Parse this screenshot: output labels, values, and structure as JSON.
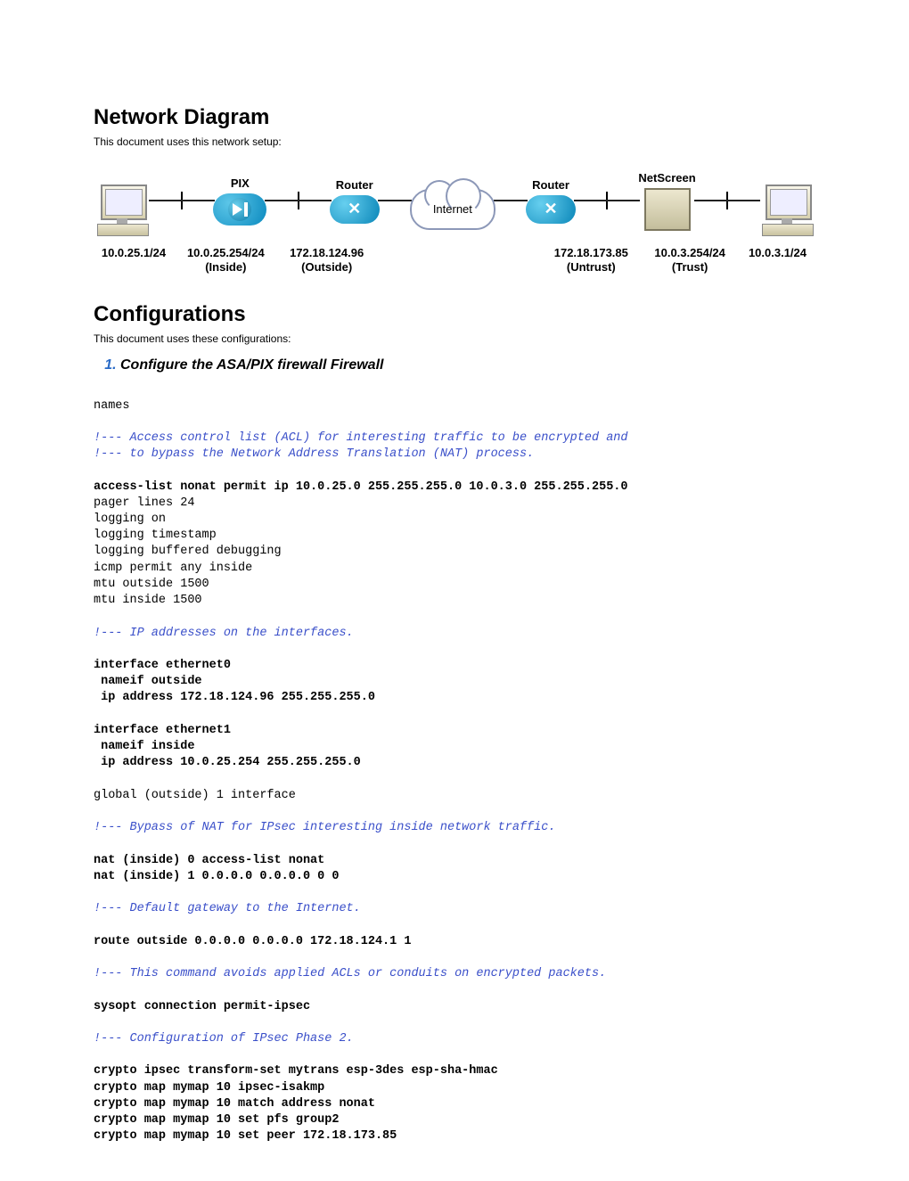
{
  "section1_title": "Network Diagram",
  "section1_lead": "This document uses this network setup:",
  "diagram": {
    "pc_left_ip": "10.0.25.1/24",
    "pix_label": "PIX",
    "pix_inside": "10.0.25.254/24",
    "pix_inside_tag": "(Inside)",
    "pix_outside": "172.18.124.96",
    "pix_outside_tag": "(Outside)",
    "router_left_label": "Router",
    "cloud_label": "Internet",
    "router_right_label": "Router",
    "ns_label": "NetScreen",
    "ns_untrust": "172.18.173.85",
    "ns_untrust_tag": "(Untrust)",
    "ns_trust": "10.0.3.254/24",
    "ns_trust_tag": "(Trust)",
    "pc_right_ip": "10.0.3.1/24"
  },
  "section2_title": "Configurations",
  "section2_lead": "This document uses these configurations:",
  "config_item_1": "Configure the ASA/PIX firewall Firewall",
  "cfg": {
    "l01": "names",
    "c01": "!--- Access control list (ACL) for interesting traffic to be encrypted and",
    "c02": "!--- to bypass the Network Address Translation (NAT) process.",
    "b01": "access-list nonat permit ip 10.0.25.0 255.255.255.0 10.0.3.0 255.255.255.0",
    "l02": "pager lines 24",
    "l03": "logging on",
    "l04": "logging timestamp",
    "l05": "logging buffered debugging",
    "l06": "icmp permit any inside",
    "l07": "mtu outside 1500",
    "l08": "mtu inside 1500",
    "c03": "!--- IP addresses on the interfaces.",
    "b02": "interface ethernet0",
    "b03": " nameif outside",
    "b04": " ip address 172.18.124.96 255.255.255.0",
    "b05": "interface ethernet1",
    "b06": " nameif inside",
    "b07": " ip address 10.0.25.254 255.255.255.0",
    "l09": "global (outside) 1 interface",
    "c04": "!--- Bypass of NAT for IPsec interesting inside network traffic.",
    "b08": "nat (inside) 0 access-list nonat",
    "b09": "nat (inside) 1 0.0.0.0 0.0.0.0 0 0",
    "c05": "!--- Default gateway to the Internet.",
    "b10": "route outside 0.0.0.0 0.0.0.0 172.18.124.1 1",
    "c06": "!--- This command avoids applied ACLs or conduits on encrypted packets.",
    "b11": "sysopt connection permit-ipsec",
    "c07": "!--- Configuration of IPsec Phase 2.",
    "b12": "crypto ipsec transform-set mytrans esp-3des esp-sha-hmac",
    "b13": "crypto map mymap 10 ipsec-isakmp",
    "b14": "crypto map mymap 10 match address nonat",
    "b15": "crypto map mymap 10 set pfs group2",
    "b16": "crypto map mymap 10 set peer 172.18.173.85"
  }
}
